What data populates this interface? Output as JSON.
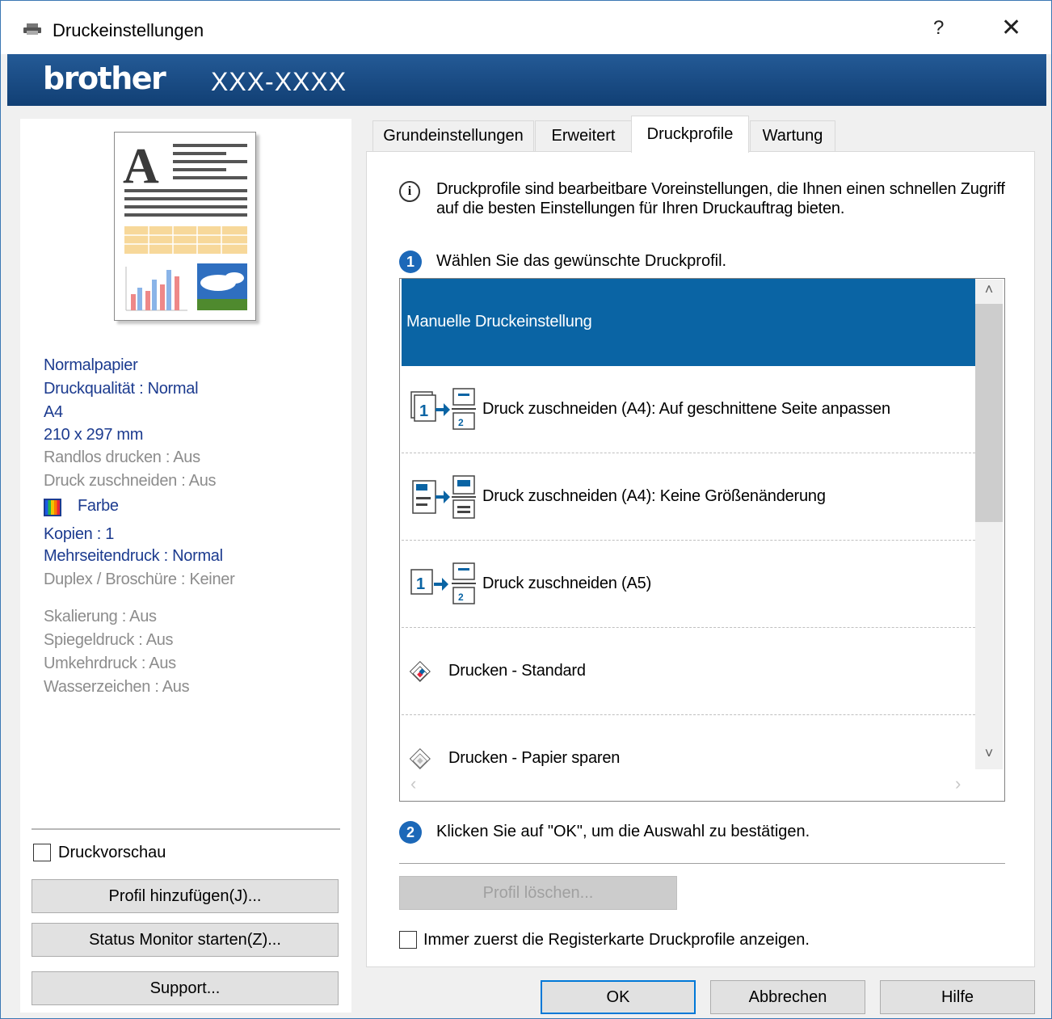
{
  "window": {
    "title": "Druckeinstellungen",
    "help": "?",
    "close": "✕"
  },
  "banner": {
    "logo": "brother",
    "model": "XXX-XXXX"
  },
  "summary": {
    "paper": "Normalpapier",
    "quality": "Druckqualität : Normal",
    "size": "A4",
    "dimensions": "210 x 297 mm",
    "borderless": "Randlos drucken : Aus",
    "cut": "Druck zuschneiden : Aus",
    "color": "Farbe",
    "copies": "Kopien : 1",
    "multipage": "Mehrseitendruck : Normal",
    "duplex": "Duplex / Broschüre : Keiner",
    "scaling": "Skalierung : Aus",
    "mirror": "Spiegeldruck : Aus",
    "reverse": "Umkehrdruck : Aus",
    "watermark": "Wasserzeichen : Aus"
  },
  "left": {
    "preview_checkbox": "Druckvorschau",
    "add_profile": "Profil hinzufügen(J)...",
    "status_monitor": "Status Monitor starten(Z)...",
    "support": "Support..."
  },
  "tabs": [
    "Grundeinstellungen",
    "Erweitert",
    "Druckprofile",
    "Wartung"
  ],
  "active_tab": "Druckprofile",
  "profiles_tab": {
    "description": "Druckprofile sind bearbeitbare Voreinstellungen, die Ihnen einen schnellen Zugriff auf die besten Einstellungen für Ihren Druckauftrag bieten.",
    "step1_num": "1",
    "step1": "Wählen Sie das gewünschte Druckprofil.",
    "items": [
      "Manuelle Druckeinstellung",
      "Druck zuschneiden (A4): Auf geschnittene Seite anpassen",
      "Druck zuschneiden (A4): Keine Größenänderung",
      "Druck zuschneiden (A5)",
      "Drucken - Standard",
      "Drucken - Papier sparen"
    ],
    "step2_num": "2",
    "step2": "Klicken Sie auf \"OK\", um die Auswahl zu bestätigen.",
    "delete_profile": "Profil löschen...",
    "always_show": "Immer zuerst die Registerkarte Druckprofile anzeigen."
  },
  "buttons": {
    "ok": "OK",
    "cancel": "Abbrechen",
    "help": "Hilfe"
  },
  "colors": {
    "banner": "#1a4c86",
    "selection": "#0a64a4",
    "summary_active": "#1c3b8f",
    "summary_inactive": "#8c8c8c"
  }
}
